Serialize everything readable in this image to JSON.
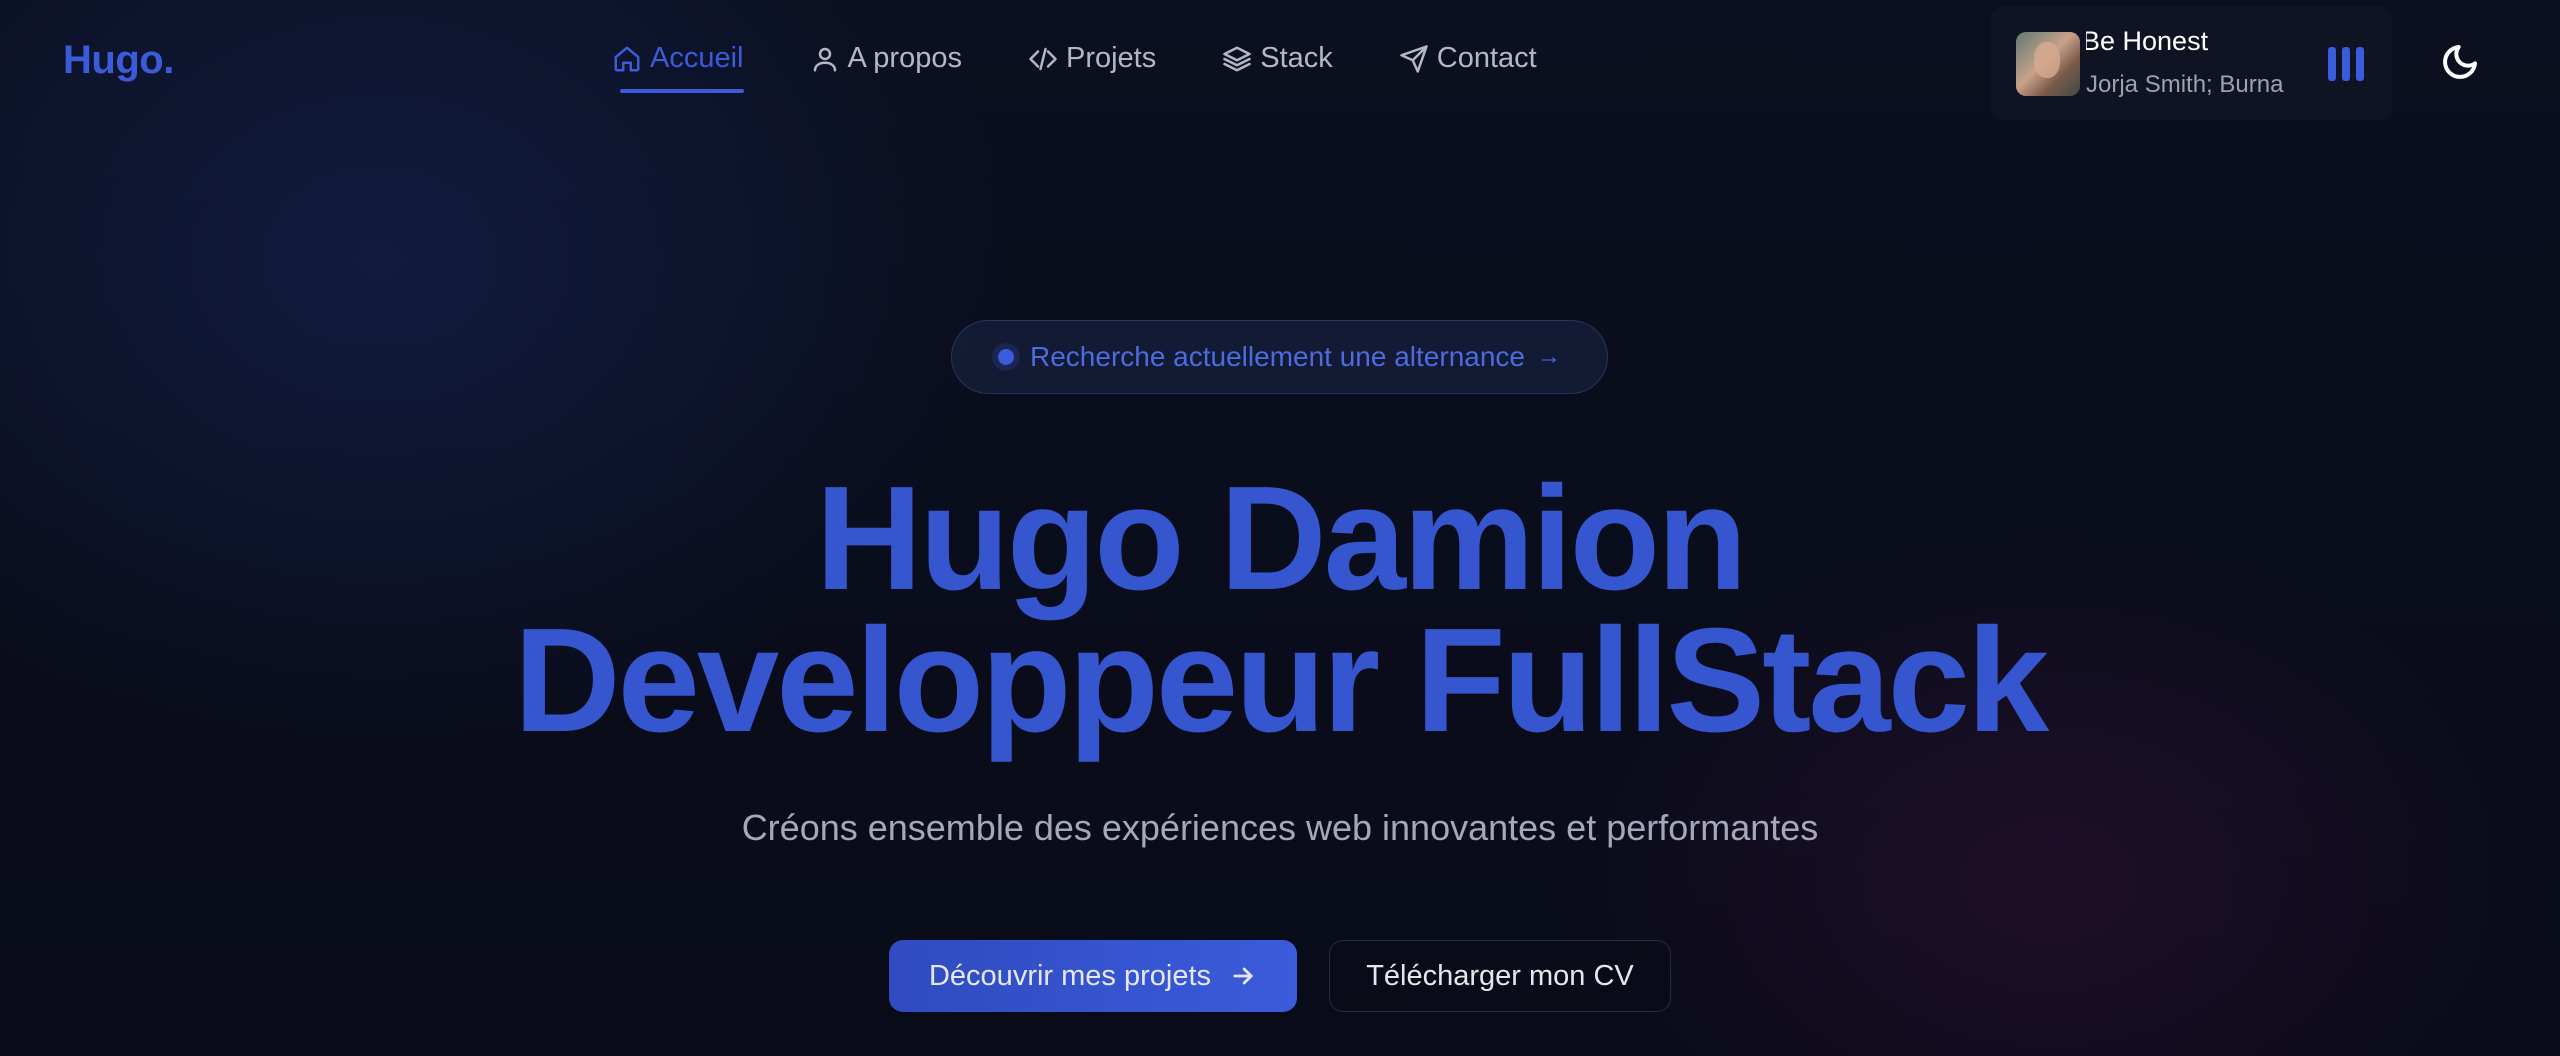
{
  "brand": {
    "logo": "Hugo."
  },
  "nav": {
    "items": [
      {
        "label": "Accueil",
        "icon": "home-icon",
        "active": true
      },
      {
        "label": "A propos",
        "icon": "user-icon",
        "active": false
      },
      {
        "label": "Projets",
        "icon": "code-icon",
        "active": false
      },
      {
        "label": "Stack",
        "icon": "layers-icon",
        "active": false
      },
      {
        "label": "Contact",
        "icon": "send-icon",
        "active": false
      }
    ]
  },
  "player": {
    "title": "Be Honest",
    "artist": "Jorja Smith; Burna",
    "cover_icon": "album-cover",
    "state_icon": "equalizer-icon"
  },
  "theme_toggle": {
    "icon": "moon-icon"
  },
  "hero": {
    "badge": "Recherche actuellement une alternance",
    "badge_arrow": "→",
    "title_line1": "Hugo Damion",
    "title_line2": "Developpeur FullStack",
    "subtitle": "Créons ensemble des expériences web innovantes et performantes",
    "cta_primary": "Découvrir mes projets",
    "cta_secondary": "Télécharger mon CV"
  },
  "colors": {
    "accent": "#3b5bdb",
    "background": "#0b0f1f",
    "text_muted": "#a3a9ba"
  }
}
